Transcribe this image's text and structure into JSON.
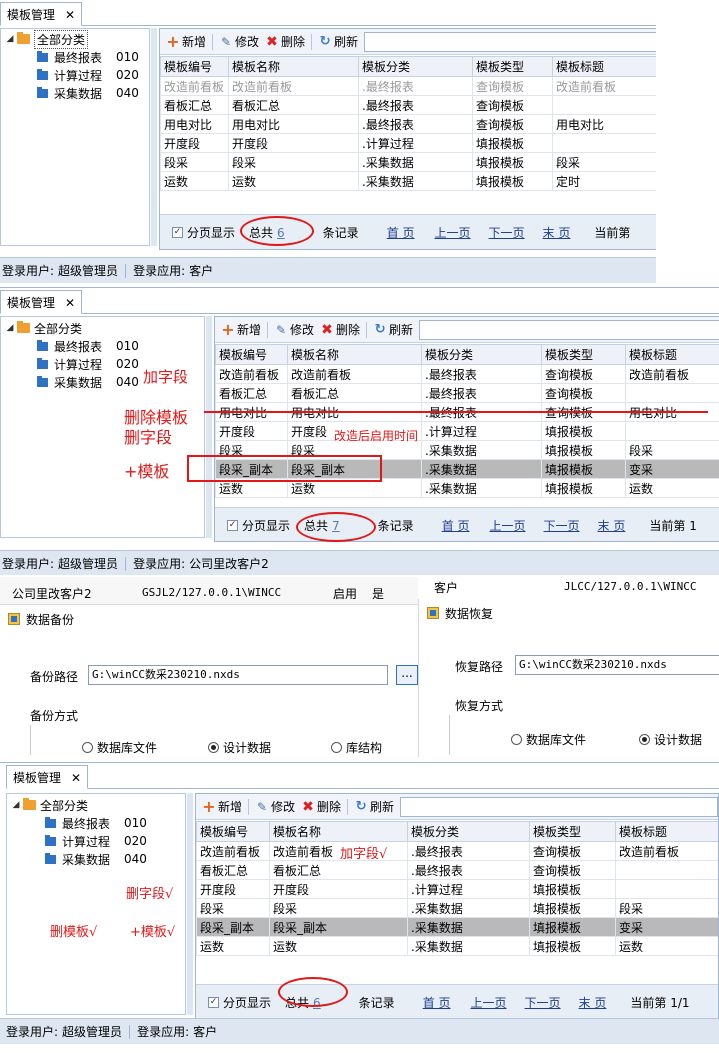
{
  "tab": {
    "title": "模板管理",
    "close": "✕"
  },
  "tree": {
    "root": "全部分类",
    "items": [
      {
        "name": "最终报表",
        "code": "010"
      },
      {
        "name": "计算过程",
        "code": "020"
      },
      {
        "name": "采集数据",
        "code": "040"
      }
    ]
  },
  "toolbar": {
    "add": "新增",
    "edit": "修改",
    "delete": "删除",
    "refresh": "刷新"
  },
  "columns": [
    "模板编号",
    "模板名称",
    "模板分类",
    "模板类型",
    "模板标题"
  ],
  "grid1": [
    [
      "改造前看板",
      "改造前看板",
      ".最终报表",
      "查询模板",
      "改造前看板"
    ],
    [
      "看板汇总",
      "看板汇总",
      ".最终报表",
      "查询模板",
      ""
    ],
    [
      "用电对比",
      "用电对比",
      ".最终报表",
      "查询模板",
      "用电对比"
    ],
    [
      "开度段",
      "开度段",
      ".计算过程",
      "填报模板",
      ""
    ],
    [
      "段采",
      "段采",
      ".采集数据",
      "填报模板",
      "段采"
    ],
    [
      "运数",
      "运数",
      ".采集数据",
      "填报模板",
      "定时"
    ]
  ],
  "grid2": [
    [
      "改造前看板",
      "改造前看板",
      ".最终报表",
      "查询模板",
      "改造前看板"
    ],
    [
      "看板汇总",
      "看板汇总",
      ".最终报表",
      "查询模板",
      ""
    ],
    [
      "用电对比",
      "用电对比",
      ".最终报表",
      "查询模板",
      "用电对比"
    ],
    [
      "开度段",
      "开度段",
      ".计算过程",
      "填报模板",
      ""
    ],
    [
      "段采",
      "段采",
      ".采集数据",
      "填报模板",
      "段采"
    ],
    [
      "段采_副本",
      "段采_副本",
      ".采集数据",
      "填报模板",
      "变采"
    ],
    [
      "运数",
      "运数",
      ".采集数据",
      "填报模板",
      "运数"
    ]
  ],
  "grid3": [
    [
      "改造前看板",
      "改造前看板",
      ".最终报表",
      "查询模板",
      "改造前看板"
    ],
    [
      "看板汇总",
      "看板汇总",
      ".最终报表",
      "查询模板",
      ""
    ],
    [
      "开度段",
      "开度段",
      ".计算过程",
      "填报模板",
      ""
    ],
    [
      "段采",
      "段采",
      ".采集数据",
      "填报模板",
      "段采"
    ],
    [
      "段采_副本",
      "段采_副本",
      ".采集数据",
      "填报模板",
      "变采"
    ],
    [
      "运数",
      "运数",
      ".采集数据",
      "填报模板",
      "运数"
    ]
  ],
  "pager": {
    "paging": "分页显示",
    "total": "总共",
    "records": "条记录",
    "first": "首 页",
    "prev": "上一页",
    "next": "下一页",
    "last": "末 页",
    "current1": "当前第",
    "current2": "当前第 1",
    "current3": "当前第 1/1",
    "count1": "6",
    "count2": "7",
    "count3": "6"
  },
  "status": {
    "user_label": "登录用户:",
    "user": "超级管理员",
    "app_label": "登录应用:",
    "app1": "客户",
    "app2": "公司里改客户2",
    "app3": "客户"
  },
  "annotations": {
    "add_field": "加字段",
    "delete_template": "删除模板",
    "delete_field": "删字段",
    "time_note": "改造后启用时间",
    "add_template": "+模板",
    "add_field_ok": "加字段√",
    "delete_field_ok": "删字段√",
    "delete_template_ok": "删模板√",
    "add_template_ok": "+模板√"
  },
  "middle": {
    "row_left": [
      "公司里改客户2",
      "GSJL2/127.0.0.1\\WINCC",
      "启用",
      "是"
    ],
    "row_right_label": "客户",
    "row_right_value": "JLCC/127.0.0.1\\WINCC",
    "backup": {
      "title": "数据备份",
      "path_label": "备份路径",
      "path": "G:\\winCC数采230210.nxds",
      "browse": "...",
      "mode_label": "备份方式",
      "options": [
        "数据库文件",
        "设计数据",
        "库结构"
      ]
    },
    "restore": {
      "title": "数据恢复",
      "path_label": "恢复路径",
      "path": "G:\\winCC数采230210.nxds",
      "mode_label": "恢复方式",
      "options": [
        "数据库文件",
        "设计数据"
      ]
    }
  }
}
